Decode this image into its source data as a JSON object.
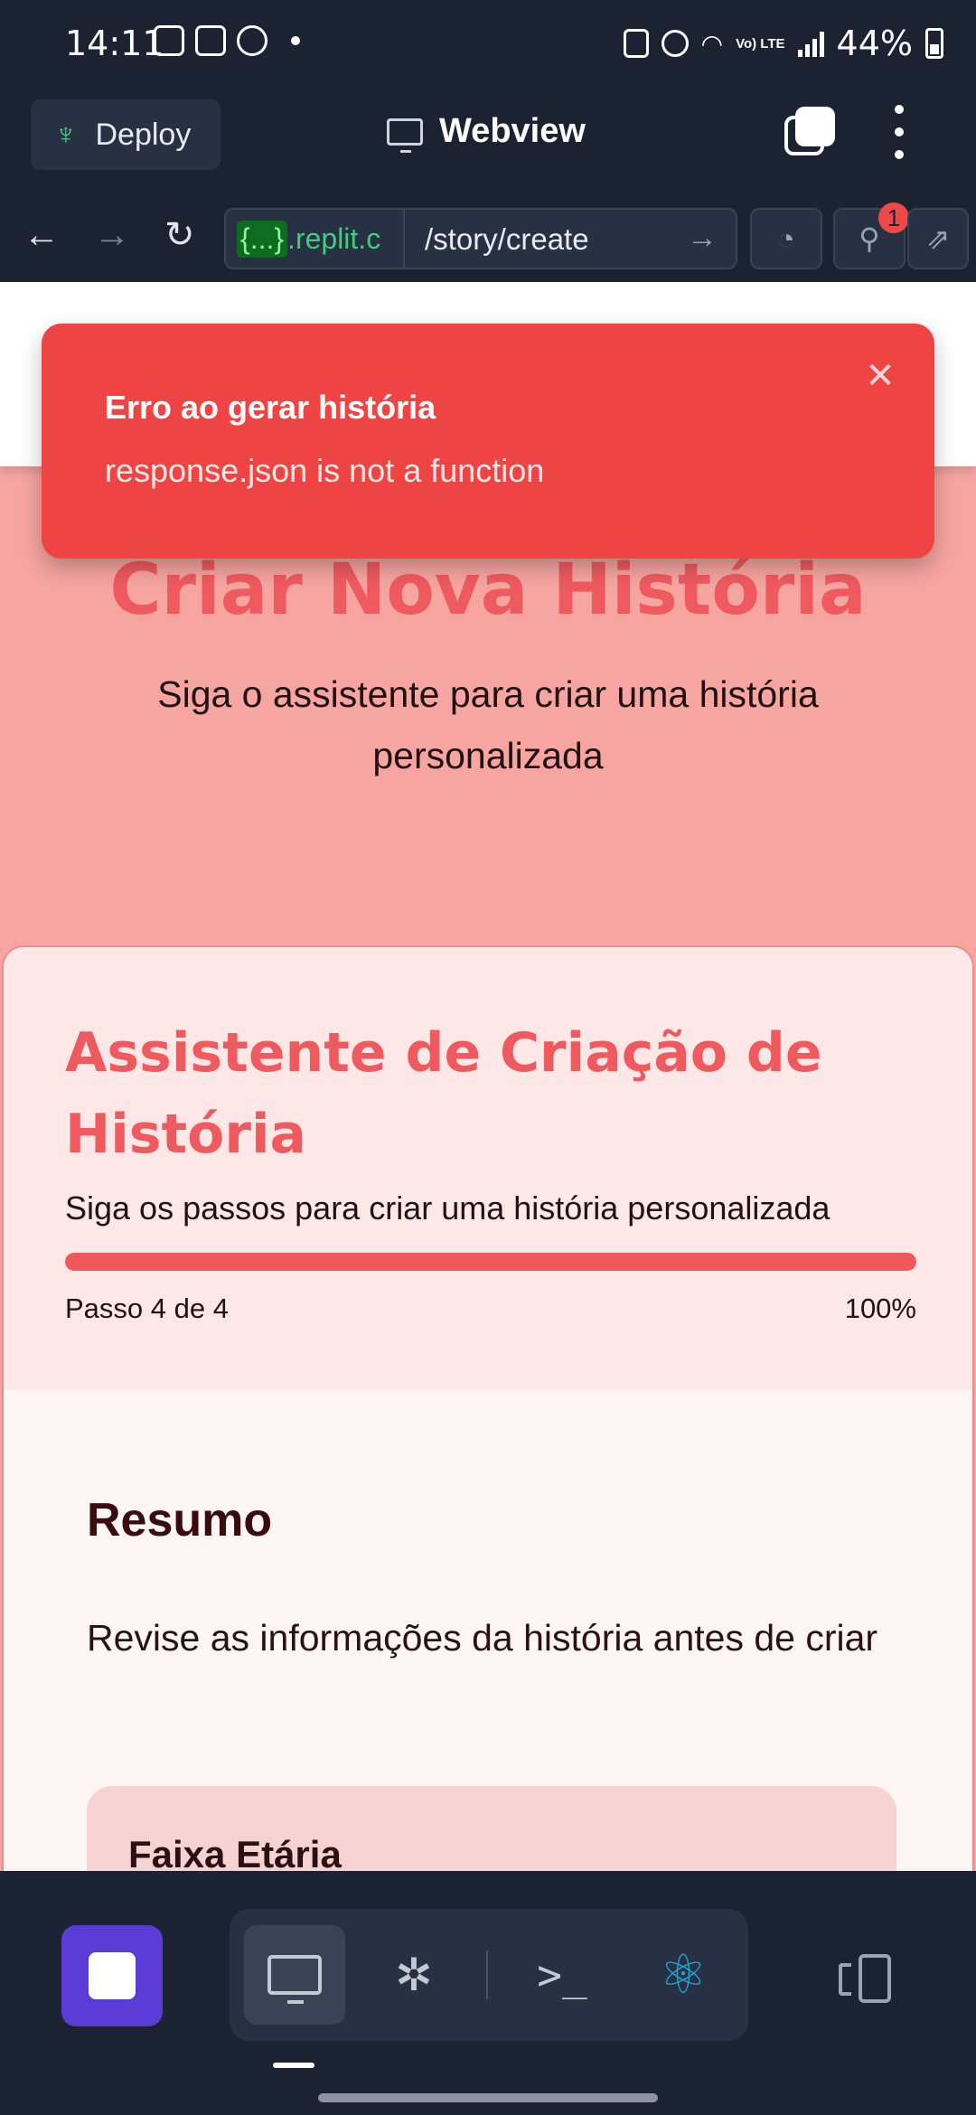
{
  "status_bar": {
    "time": "14:11",
    "lte_label": "Vo) LTE",
    "battery": "44%"
  },
  "app_bar": {
    "deploy_label": "Deploy",
    "title": "Webview"
  },
  "url_bar": {
    "host": ".replit.c",
    "host_prefix": "{...}",
    "path": "/story/create",
    "badge_count": "1"
  },
  "page": {
    "hero_title": "Criar Nova História",
    "hero_subtitle": "Siga o assistente para criar uma história personalizada",
    "wizard": {
      "title": "Assistente de Criação de História",
      "description": "Siga os passos para criar uma história personalizada",
      "step_text": "Passo 4 de 4",
      "progress_label": "100%",
      "progress_fraction": 1.0
    },
    "summary": {
      "title": "Resumo",
      "description": "Revise as informações da história antes de criar",
      "age_label": "Faixa Etária"
    }
  },
  "toast": {
    "title": "Erro ao gerar história",
    "message": "response.json is not a function"
  },
  "colors": {
    "accent": "#ef5a5f",
    "toast_bg": "#ef4444",
    "app_dark": "#1b2232",
    "stop_button": "#5b3bd6"
  }
}
